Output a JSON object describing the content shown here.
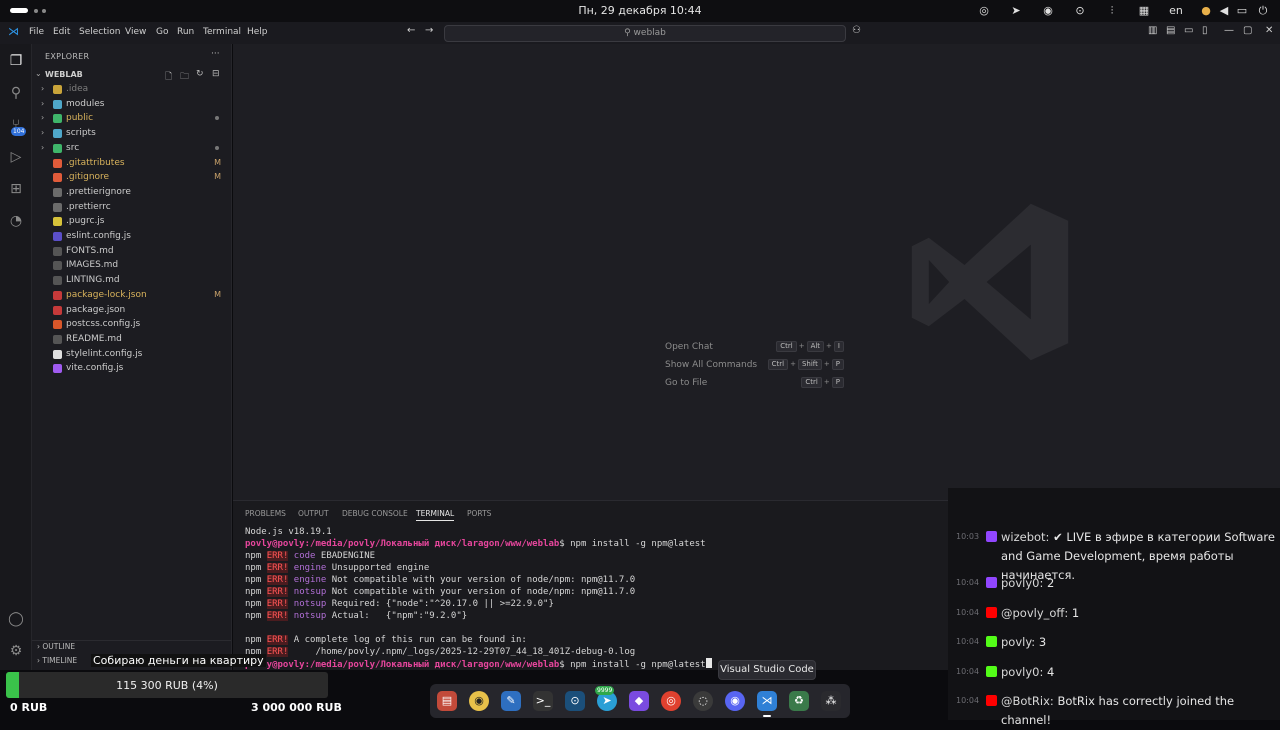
{
  "system": {
    "clock": "Пн, 29 декабря 10:44",
    "lang": "en"
  },
  "menubar": {
    "items": [
      "File",
      "Edit",
      "Selection",
      "View",
      "Go",
      "Run",
      "Terminal",
      "Help"
    ],
    "search_text": "weblab"
  },
  "activity": {
    "scm_badge": "104"
  },
  "explorer": {
    "title": "EXPLORER",
    "more": "···",
    "root": "WEBLAB",
    "items": [
      {
        "name": ".idea",
        "folder": true,
        "color": "#7d7d7d",
        "icon_color": "#c9a43a",
        "badge": ""
      },
      {
        "name": "modules",
        "folder": true,
        "color": "#cccccc",
        "icon_color": "#4fa7c9",
        "badge": ""
      },
      {
        "name": "public",
        "folder": true,
        "color": "#d9b35c",
        "icon_color": "#3fb56a",
        "badge": "dot"
      },
      {
        "name": "scripts",
        "folder": true,
        "color": "#cccccc",
        "icon_color": "#4fa7c9",
        "badge": ""
      },
      {
        "name": "src",
        "folder": true,
        "color": "#cccccc",
        "icon_color": "#3fb56a",
        "badge": "dot"
      },
      {
        "name": ".gitattributes",
        "folder": false,
        "color": "#d9b35c",
        "icon_color": "#e05b3a",
        "badge": "M"
      },
      {
        "name": ".gitignore",
        "folder": false,
        "color": "#d9b35c",
        "icon_color": "#e05b3a",
        "badge": "M"
      },
      {
        "name": ".prettierignore",
        "folder": false,
        "color": "#cccccc",
        "icon_color": "#6b6b6b",
        "badge": ""
      },
      {
        "name": ".prettierrc",
        "folder": false,
        "color": "#cccccc",
        "icon_color": "#6b6b6b",
        "badge": ""
      },
      {
        "name": ".pugrc.js",
        "folder": false,
        "color": "#cccccc",
        "icon_color": "#d6c23a",
        "badge": ""
      },
      {
        "name": "eslint.config.js",
        "folder": false,
        "color": "#cccccc",
        "icon_color": "#5b4fc9",
        "badge": ""
      },
      {
        "name": "FONTS.md",
        "folder": false,
        "color": "#cccccc",
        "icon_color": "#555555",
        "badge": ""
      },
      {
        "name": "IMAGES.md",
        "folder": false,
        "color": "#cccccc",
        "icon_color": "#555555",
        "badge": ""
      },
      {
        "name": "LINTING.md",
        "folder": false,
        "color": "#cccccc",
        "icon_color": "#555555",
        "badge": ""
      },
      {
        "name": "package-lock.json",
        "folder": false,
        "color": "#d9b35c",
        "icon_color": "#c63a3a",
        "badge": "M"
      },
      {
        "name": "package.json",
        "folder": false,
        "color": "#cccccc",
        "icon_color": "#c63a3a",
        "badge": ""
      },
      {
        "name": "postcss.config.js",
        "folder": false,
        "color": "#cccccc",
        "icon_color": "#d8572a",
        "badge": ""
      },
      {
        "name": "README.md",
        "folder": false,
        "color": "#cccccc",
        "icon_color": "#555555",
        "badge": ""
      },
      {
        "name": "stylelint.config.js",
        "folder": false,
        "color": "#cccccc",
        "icon_color": "#e0e0e0",
        "badge": ""
      },
      {
        "name": "vite.config.js",
        "folder": false,
        "color": "#cccccc",
        "icon_color": "#a05bf0",
        "badge": ""
      }
    ],
    "outline": "OUTLINE",
    "timeline": "TIMELINE"
  },
  "welcome": {
    "hints": [
      {
        "label": "Open Chat",
        "keys": [
          "Ctrl",
          "Alt",
          "I"
        ]
      },
      {
        "label": "Show All Commands",
        "keys": [
          "Ctrl",
          "Shift",
          "P"
        ]
      },
      {
        "label": "Go to File",
        "keys": [
          "Ctrl",
          "P"
        ]
      }
    ]
  },
  "panel": {
    "tabs": [
      "PROBLEMS",
      "OUTPUT",
      "DEBUG CONSOLE",
      "TERMINAL",
      "PORTS"
    ],
    "active_tab": "TERMINAL",
    "node_version": "Node.js v18.19.1",
    "prompt_user": "povly@povly",
    "prompt_path": ":/media/povly/Локальный диск/laragon/www/weblab",
    "command": "$ npm install -g npm@latest",
    "err_lines": [
      {
        "key": "code",
        "text": " EBADENGINE"
      },
      {
        "key": "engine",
        "text": " Unsupported engine"
      },
      {
        "key": "engine",
        "text": " Not compatible with your version of node/npm: npm@11.7.0"
      },
      {
        "key": "notsup",
        "text": " Not compatible with your version of node/npm: npm@11.7.0"
      },
      {
        "key": "notsup",
        "text": " Required: {\"node\":\"^20.17.0 || >=22.9.0\"}"
      },
      {
        "key": "notsup",
        "text": " Actual:   {\"npm\":\"9.2.0\"}"
      }
    ],
    "log_line1": " A complete log of this run can be found in:",
    "log_line2": "     /home/povly/.npm/_logs/2025-12-29T07_44_18_401Z-debug-0.log",
    "npm": "npm",
    "err": "ERR!"
  },
  "chat": {
    "messages": [
      {
        "time": "10:03",
        "user": "wizebot:",
        "text": " ✔ LIVE в эфире в категории Software and Game Development, время работы начинается.",
        "icon_color": "#9146ff"
      },
      {
        "time": "10:04",
        "user": "povly0:",
        "text": " 2",
        "icon_color": "#9146ff"
      },
      {
        "time": "10:04",
        "user": "@povly_off:",
        "text": " 1",
        "icon_color": "#ff0000"
      },
      {
        "time": "10:04",
        "user": "povly:",
        "text": " 3",
        "icon_color": "#53fc18"
      },
      {
        "time": "10:04",
        "user": "povly0:",
        "text": " 4",
        "icon_color": "#53fc18"
      },
      {
        "time": "10:04",
        "user": "@BotRix:",
        "text": " BotRix has correctly joined the channel!",
        "icon_color": "#ff0000"
      }
    ]
  },
  "donation": {
    "title": "Собираю деньги на квартиру",
    "progress_label": "115 300 RUB (4%)",
    "progress": 0.04,
    "min": "0 RUB",
    "max": "3 000 000 RUB"
  },
  "dock": {
    "tooltip": "Visual Studio Code",
    "badge": "9999"
  }
}
